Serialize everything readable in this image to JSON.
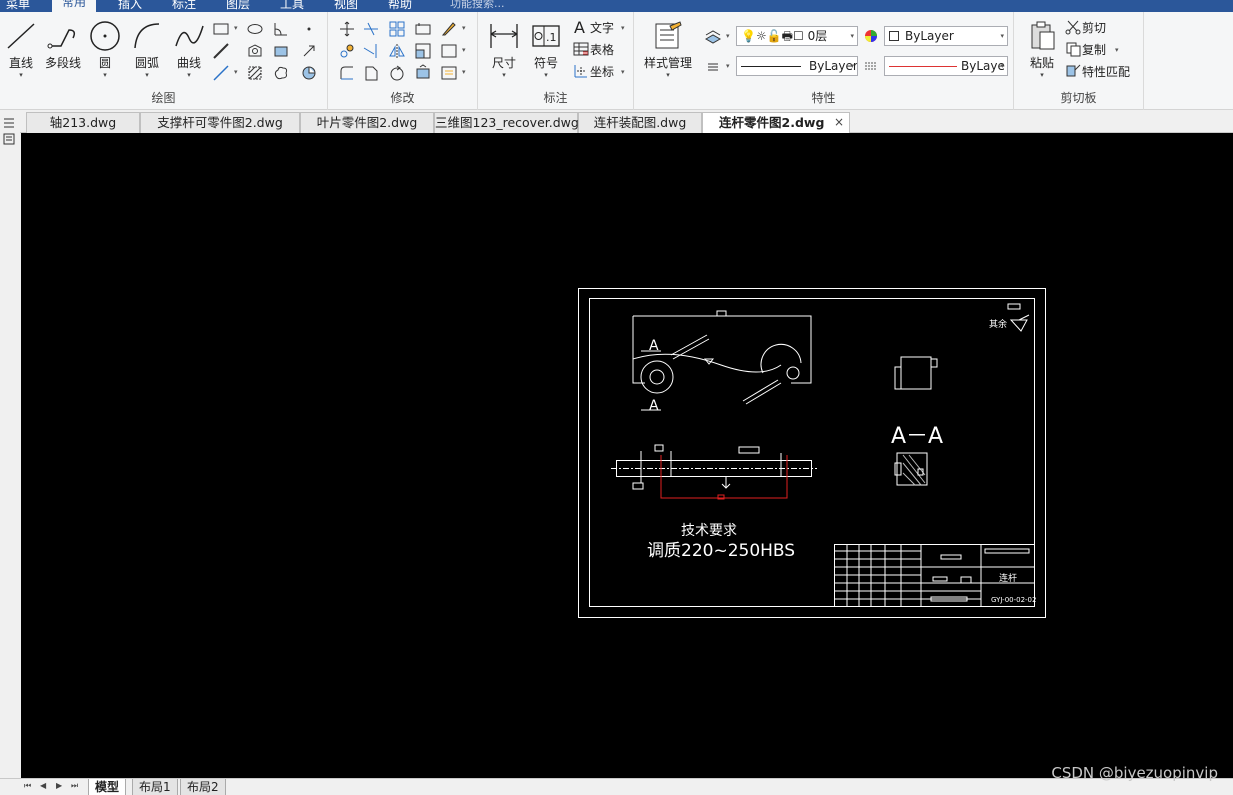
{
  "menu": {
    "items": [
      "菜单",
      "常用",
      "插入",
      "标注",
      "图层",
      "工具",
      "视图",
      "帮助"
    ],
    "active_index": 1,
    "search_placeholder": "功能搜索..."
  },
  "ribbon": {
    "groups": {
      "draw": "绘图",
      "modify": "修改",
      "annotate": "标注",
      "properties": "特性",
      "clipboard": "剪切板"
    },
    "draw": {
      "line": "直线",
      "polyline": "多段线",
      "circle": "圆",
      "arc": "圆弧",
      "curve": "曲线"
    },
    "annotate": {
      "dimension": "尺寸",
      "symbol": "符号",
      "text": "文字",
      "table": "表格",
      "coordinate": "坐标"
    },
    "properties": {
      "style_manager": "样式管理",
      "layer_value": "0层",
      "color_value": "ByLayer",
      "linetype_value": "ByLayer",
      "lineweight_value": "ByLaye"
    },
    "clipboard": {
      "paste": "粘贴",
      "cut": "剪切",
      "copy": "复制",
      "match_props": "特性匹配"
    }
  },
  "file_tabs": [
    {
      "label": "轴213.dwg"
    },
    {
      "label": "支撑杆可零件图2.dwg"
    },
    {
      "label": "叶片零件图2.dwg"
    },
    {
      "label": "三维图123_recover.dwg"
    },
    {
      "label": "连杆装配图.dwg"
    },
    {
      "label": "连杆零件图2.dwg"
    }
  ],
  "active_file_tab": 5,
  "drawing": {
    "section_label": "A－A",
    "marker_top": "A",
    "marker_bottom": "A",
    "roughness_note": "其余",
    "tech_title": "技术要求",
    "tech_body": "调质220~250HBS",
    "title_part": "连杆",
    "title_code": "GYJ-00-02-02"
  },
  "layout_tabs": [
    "模型",
    "布局1",
    "布局2"
  ],
  "watermark": "CSDN @biyezuopinvip"
}
